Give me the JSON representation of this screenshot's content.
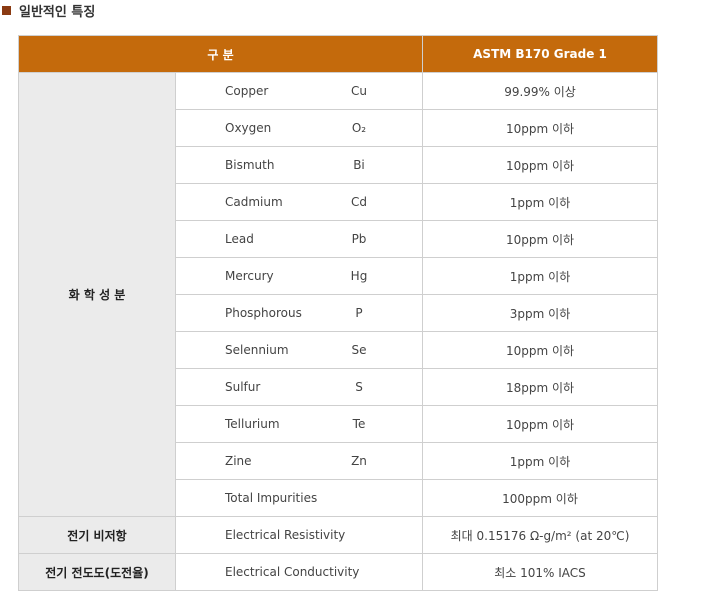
{
  "section": {
    "title": "일반적인 특징"
  },
  "table": {
    "header": {
      "col1": "구 분",
      "col2": "ASTM B170 Grade 1"
    },
    "chemical": {
      "label": "화 학 성 분",
      "rows": [
        {
          "name": "Copper",
          "symbol": "Cu",
          "value": "99.99% 이상"
        },
        {
          "name": "Oxygen",
          "symbol": "O₂",
          "value": "10ppm 이하"
        },
        {
          "name": "Bismuth",
          "symbol": "Bi",
          "value": "10ppm 이하"
        },
        {
          "name": "Cadmium",
          "symbol": "Cd",
          "value": "1ppm 이하"
        },
        {
          "name": "Lead",
          "symbol": "Pb",
          "value": "10ppm 이하"
        },
        {
          "name": "Mercury",
          "symbol": "Hg",
          "value": "1ppm 이하"
        },
        {
          "name": "Phosphorous",
          "symbol": "P",
          "value": "3ppm 이하"
        },
        {
          "name": "Selennium",
          "symbol": "Se",
          "value": "10ppm 이하"
        },
        {
          "name": "Sulfur",
          "symbol": "S",
          "value": "18ppm 이하"
        },
        {
          "name": "Tellurium",
          "symbol": "Te",
          "value": "10ppm 이하"
        },
        {
          "name": "Zine",
          "symbol": "Zn",
          "value": "1ppm 이하"
        },
        {
          "name": "Total Impurities",
          "symbol": "",
          "value": "100ppm 이하"
        }
      ]
    },
    "resistivity": {
      "label": "전기 비저항",
      "name": "Electrical Resistivity",
      "value": "최대 0.15176 Ω-g/m² (at 20℃)"
    },
    "conductivity": {
      "label": "전기 전도도(도전율)",
      "name": "Electrical Conductivity",
      "value": "최소 101% IACS"
    }
  },
  "colors": {
    "header_bg": "#c46a0c",
    "group_bg": "#ebebeb",
    "bullet": "#8a3a12"
  }
}
